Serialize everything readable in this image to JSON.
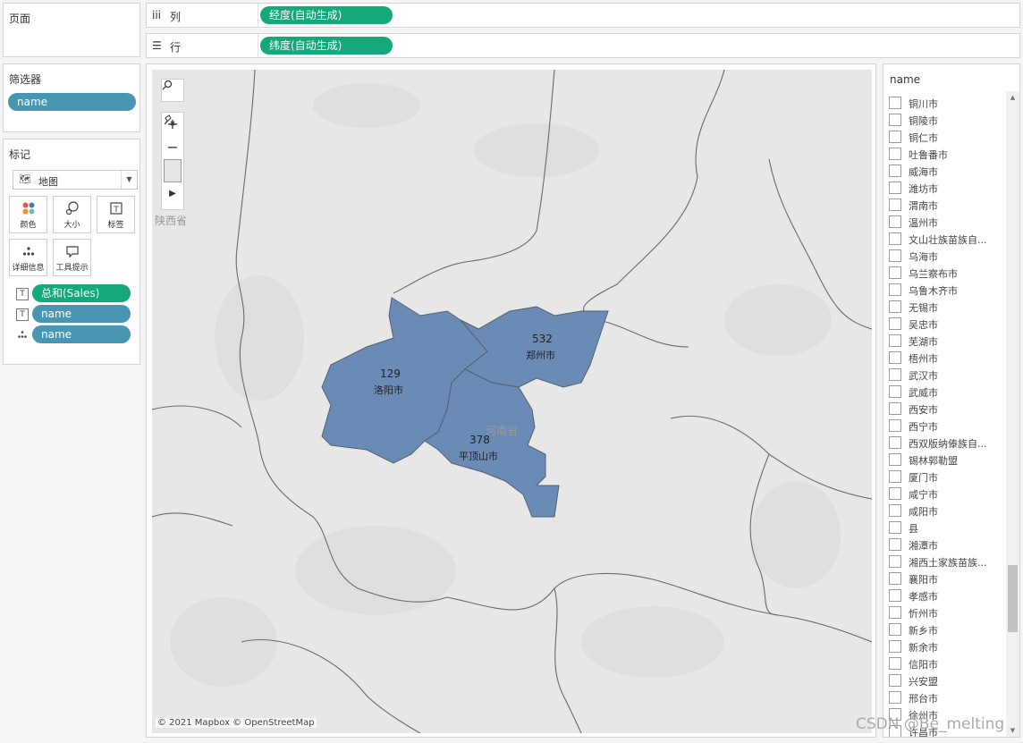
{
  "pages_card": {
    "title": "页面"
  },
  "columns_shelf": {
    "icon": "iii",
    "label": "列",
    "pill": "经度(自动生成)"
  },
  "rows_shelf": {
    "icon": "☰",
    "label": "行",
    "pill": "纬度(自动生成)"
  },
  "filters_card": {
    "title": "筛选器",
    "pill": "name"
  },
  "marks_card": {
    "title": "标记",
    "mark_type": "地图",
    "buttons": [
      {
        "label": "颜色",
        "icon": "color-icon"
      },
      {
        "label": "大小",
        "icon": "size-icon"
      },
      {
        "label": "标签",
        "icon": "label-icon"
      },
      {
        "label": "详细信息",
        "icon": "detail-icon"
      },
      {
        "label": "工具提示",
        "icon": "tooltip-icon"
      }
    ],
    "fields": [
      {
        "icon": "label-icon",
        "pill": "总和(Sales)"
      },
      {
        "icon": "label-icon",
        "pill": "name"
      },
      {
        "icon": "detail-icon",
        "pill": "name"
      }
    ]
  },
  "map": {
    "regions": [
      {
        "name": "洛阳市",
        "value": "129"
      },
      {
        "name": "郑州市",
        "value": "532"
      },
      {
        "name": "平顶山市",
        "value": "378"
      }
    ],
    "province_labels": [
      "陕西省",
      "河南省"
    ],
    "attribution": "© 2021 Mapbox © OpenStreetMap",
    "region_color": "#6a8bb5"
  },
  "name_filter": {
    "title": "name",
    "items": [
      "铜川市",
      "铜陵市",
      "铜仁市",
      "吐鲁番市",
      "威海市",
      "潍坊市",
      "渭南市",
      "温州市",
      "文山壮族苗族自...",
      "乌海市",
      "乌兰察布市",
      "乌鲁木齐市",
      "无锡市",
      "吴忠市",
      "芜湖市",
      "梧州市",
      "武汉市",
      "武威市",
      "西安市",
      "西宁市",
      "西双版纳傣族自...",
      "锡林郭勒盟",
      "厦门市",
      "咸宁市",
      "咸阳市",
      "县",
      "湘潭市",
      "湘西土家族苗族...",
      "襄阳市",
      "孝感市",
      "忻州市",
      "新乡市",
      "新余市",
      "信阳市",
      "兴安盟",
      "邢台市",
      "徐州市",
      "许昌市"
    ]
  },
  "watermark": "CSDN @Be_melting"
}
